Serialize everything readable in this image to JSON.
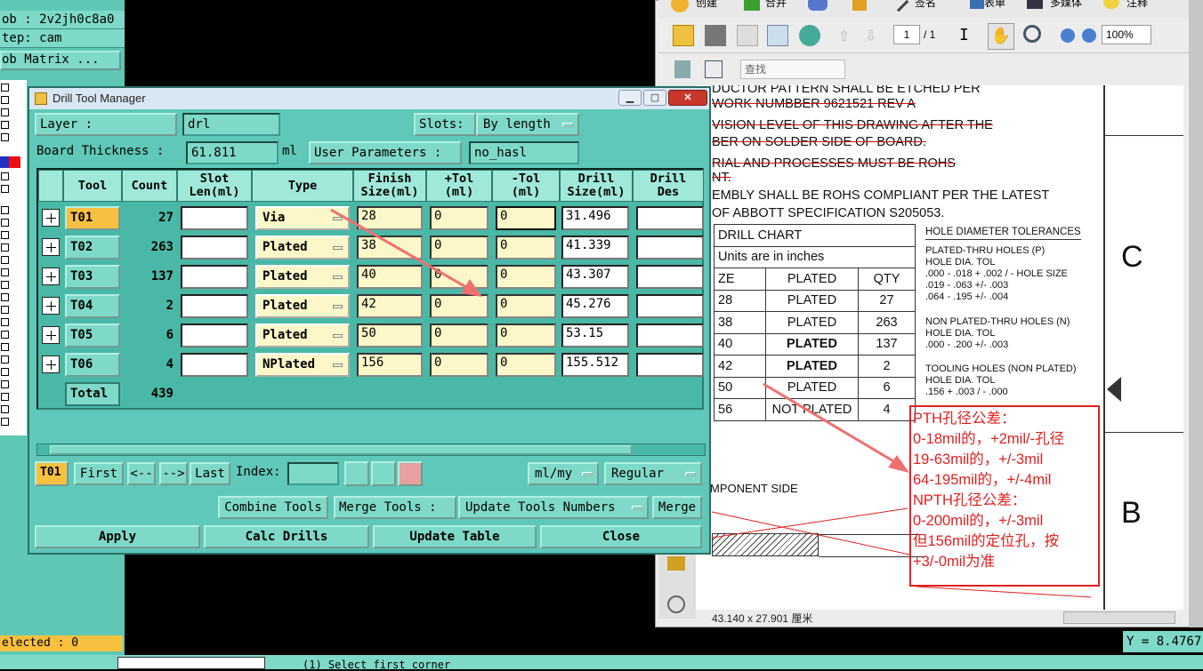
{
  "cam": {
    "job_label": "ob : 2v2jh0c8a0",
    "step_label": "tep: cam",
    "job_matrix": "ob Matrix ...",
    "selected": "elected : 0",
    "bottom_prompt": "(1)  Select first corner",
    "y_readout": "Y = 8.4767"
  },
  "pdf": {
    "toolbar1": [
      "创建",
      "合并",
      "签名",
      "表单",
      "多媒体",
      "注释"
    ],
    "page_num": "1",
    "page_total": "/ 1",
    "zoom": "100%",
    "find_placeholder": "查找",
    "status": "43.140 x 27.901 厘米",
    "lines": [
      {
        "text": "DUCTOR PATTERN SHALL BE ETCHED PER",
        "strike": false
      },
      {
        "text": "WORK NUMBBER 9621521 REV A",
        "strike": true
      },
      {
        "text": "VISION LEVEL OF THIS DRAWING AFTER THE",
        "strike": true
      },
      {
        "text": "BER ON SOLDER SIDE OF BOARD.",
        "strike": true
      },
      {
        "text": "RIAL AND PROCESSES MUST BE ROHS",
        "strike": true
      },
      {
        "text": "NT.",
        "strike": true
      },
      {
        "text": "EMBLY SHALL BE ROHS COMPLIANT PER THE LATEST",
        "strike": false
      },
      {
        "text": "OF ABBOTT SPECIFICATION S205053.",
        "strike": false
      }
    ],
    "drill_chart_title": "DRILL CHART",
    "units_note": "Units are in inches",
    "chart_headers": [
      "ZE",
      "PLATED",
      "QTY"
    ],
    "chart_rows": [
      [
        "28",
        "PLATED",
        "27"
      ],
      [
        "38",
        "PLATED",
        "263"
      ],
      [
        "40",
        "PLATED",
        "137"
      ],
      [
        "42",
        "PLATED",
        "2"
      ],
      [
        "50",
        "PLATED",
        "6"
      ],
      [
        "56",
        "NOT PLATED",
        "4"
      ]
    ],
    "tol_title": "HOLE DIAMETER TOLERANCES",
    "tol_lines": [
      "PLATED-THRU HOLES (P)",
      "HOLE DIA.                 TOL",
      ".000 - .018          + .002 / - HOLE SIZE",
      ".019 - .063          +/- .003",
      ".064 - .195          +/- .004",
      "",
      "NON PLATED-THRU HOLES (N)",
      "HOLE DIA.                 TOL",
      ".000 - .200          +/- .003",
      "",
      "TOOLING HOLES (NON PLATED)",
      "HOLE DIA.                 TOL",
      ".156                    + .003 / - .000"
    ],
    "letter_c": "C",
    "letter_b": "B",
    "component_side": "MPONENT SIDE",
    "note_lines": [
      "PTH孔径公差：",
      "0-18mil的，+2mil/-孔径",
      "19-63mil的，+/-3mil",
      "64-195mil的，+/-4mil",
      "NPTH孔径公差：",
      "0-200mil的，+/-3mil",
      "但156mil的定位孔，按",
      "+3/-0mil为准"
    ]
  },
  "dtm": {
    "title": "Drill Tool Manager",
    "layer_label": "Layer         :",
    "layer_value": "drl",
    "slots_label": "Slots:",
    "slots_value": "By length",
    "board_thickness_label": "Board Thickness :",
    "board_thickness_value": "61.811",
    "board_thickness_unit": "ml",
    "user_params_label": "User Parameters :",
    "user_params_value": "no_hasl",
    "headers": [
      "Tool",
      "Count",
      "Slot\nLen(ml)",
      "Type",
      "Finish\nSize(ml)",
      "+Tol\n(ml)",
      "-Tol\n(ml)",
      "Drill\nSize(ml)",
      "Drill\nDes"
    ],
    "rows": [
      {
        "tool": "T01",
        "count": "27",
        "slot": "",
        "type": "Via",
        "finish": "28",
        "ptol": "0",
        "mtol": "0",
        "drill": "31.496",
        "des": ""
      },
      {
        "tool": "T02",
        "count": "263",
        "slot": "",
        "type": "Plated",
        "finish": "38",
        "ptol": "0",
        "mtol": "0",
        "drill": "41.339",
        "des": ""
      },
      {
        "tool": "T03",
        "count": "137",
        "slot": "",
        "type": "Plated",
        "finish": "40",
        "ptol": "0",
        "mtol": "0",
        "drill": "43.307",
        "des": ""
      },
      {
        "tool": "T04",
        "count": "2",
        "slot": "",
        "type": "Plated",
        "finish": "42",
        "ptol": "0",
        "mtol": "0",
        "drill": "45.276",
        "des": ""
      },
      {
        "tool": "T05",
        "count": "6",
        "slot": "",
        "type": "Plated",
        "finish": "50",
        "ptol": "0",
        "mtol": "0",
        "drill": "53.15",
        "des": ""
      },
      {
        "tool": "T06",
        "count": "4",
        "slot": "",
        "type": "NPlated",
        "finish": "156",
        "ptol": "0",
        "mtol": "0",
        "drill": "155.512",
        "des": ""
      }
    ],
    "total_label": "Total",
    "total_count": "439",
    "current_tool": "T01",
    "nav": {
      "first": "First",
      "prev": "<--",
      "next": "-->",
      "last": "Last",
      "index_label": "Index:"
    },
    "units_value": "ml/my",
    "mode_value": "Regular",
    "combine_tools": "Combine Tools",
    "merge_tools_label": "Merge Tools :",
    "merge_tools_value": "Update Tools Numbers",
    "merge_btn": "Merge",
    "apply": "Apply",
    "calc_drills": "Calc Drills",
    "update_table": "Update Table",
    "close": "Close"
  }
}
